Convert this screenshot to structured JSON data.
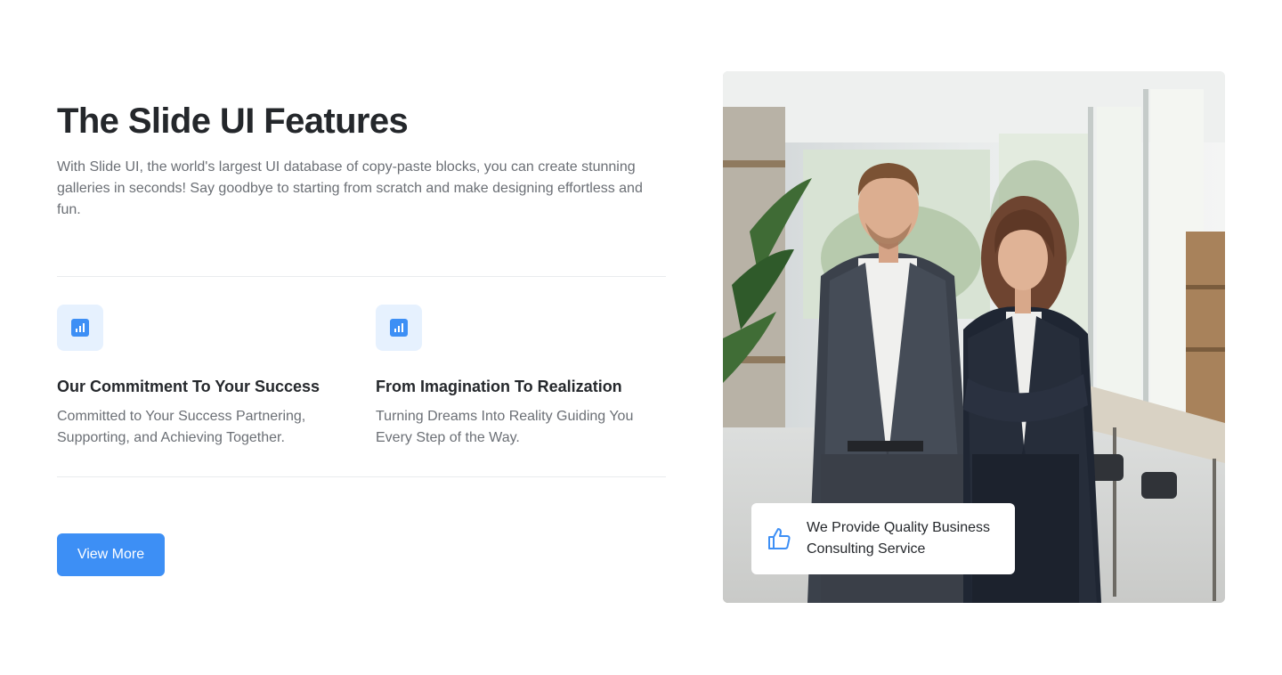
{
  "section": {
    "title": "The Slide UI Features",
    "description": "With Slide UI, the world's largest UI database of copy-paste blocks, you can create stunning galleries in seconds! Say goodbye to starting from scratch and make designing effortless and fun."
  },
  "features": [
    {
      "icon": "chart-icon",
      "title": "Our Commitment To Your Success",
      "text": "Committed to Your Success Partnering, Supporting, and Achieving Together."
    },
    {
      "icon": "chart-icon",
      "title": "From Imagination To Realization",
      "text": "Turning Dreams Into Reality Guiding You Every Step of the Way."
    }
  ],
  "cta": {
    "label": "View More"
  },
  "photo": {
    "badge_icon": "thumbs-up-icon",
    "badge_text": "We Provide Quality Business Consulting Service"
  },
  "colors": {
    "accent": "#3d8ff5",
    "icon_bg": "#e6f1fe",
    "text_muted": "#6b6f75"
  }
}
